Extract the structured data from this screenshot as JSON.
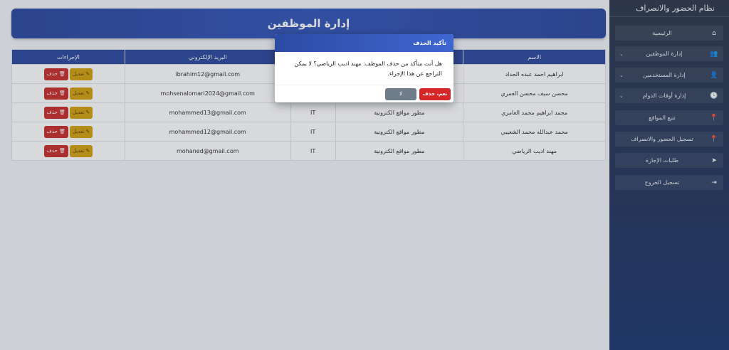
{
  "sidebar": {
    "title": "نظام الحضور والانصراف",
    "items": [
      {
        "label": "الرئيسية",
        "icon": "home-icon",
        "glyph": "⌂",
        "chevron": false
      },
      {
        "label": "إدارة الموظفين",
        "icon": "users-icon",
        "glyph": "👥",
        "chevron": true
      },
      {
        "label": "إدارة المستخدمين",
        "icon": "user-gear-icon",
        "glyph": "👤",
        "chevron": true
      },
      {
        "label": "إدارة أوقات الدوام",
        "icon": "clock-icon",
        "glyph": "🕓",
        "chevron": true
      },
      {
        "label": "تتبع المواقع",
        "icon": "map-pin-icon",
        "glyph": "📍",
        "chevron": false
      },
      {
        "label": "تسجيل الحضور والانصراف",
        "icon": "map-pin-icon",
        "glyph": "📍",
        "chevron": false
      },
      {
        "label": "طلبات الإجازة",
        "icon": "paper-plane-icon",
        "glyph": "➤",
        "chevron": false
      },
      {
        "label": "تسجيل الخروج",
        "icon": "sign-out-icon",
        "glyph": "⇥",
        "chevron": false
      }
    ]
  },
  "main": {
    "title": "إدارة الموظفين",
    "table": {
      "headers": [
        "الاسم",
        "",
        "",
        "البريد الإلكتروني",
        "الإجراءات"
      ],
      "edit_label": "تعديل",
      "delete_label": "حذف",
      "rows": [
        {
          "name": "ابراهيم احمد عبده الحداد",
          "job": "",
          "dept": "",
          "email": "ibrahim12@gmail.com"
        },
        {
          "name": "محسن سيف محسن العمري",
          "job": "",
          "dept": "",
          "email": "mohsenalomari2024@gmail.com"
        },
        {
          "name": "محمد ابراهيم محمد العامري",
          "job": "مطور مواقع الكترونية",
          "dept": "IT",
          "email": "mohammed13@gmail.com"
        },
        {
          "name": "محمد عبدالله محمد الشعيبي",
          "job": "مطور مواقع الكترونية",
          "dept": "IT",
          "email": "mohammed12@gmail.com"
        },
        {
          "name": "مهند اديب الرياضي",
          "job": "مطور مواقع الكترونية",
          "dept": "IT",
          "email": "mohaned@gmail.com"
        }
      ]
    }
  },
  "modal": {
    "title": "تأكيد الحذف",
    "message": "هل أنت متأكد من حذف الموظف: مهند اديب الرياضي؟ لا يمكن التراجع عن هذا الإجراء.",
    "confirm_label": "نعم، حذف",
    "cancel_label": "لا"
  },
  "colors": {
    "header": "#2c4a9e",
    "edit": "#d4a112",
    "delete": "#c9302c",
    "confirm": "#d62728",
    "cancel": "#6f7c8a"
  }
}
